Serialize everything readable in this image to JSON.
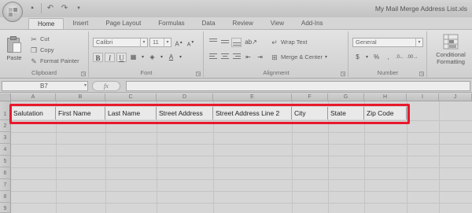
{
  "window": {
    "title": "My Mail Merge Address List.xls"
  },
  "qat": {
    "save_icon": "save-icon",
    "undo_icon": "undo-icon",
    "redo_icon": "redo-icon"
  },
  "tabs": [
    "Home",
    "Insert",
    "Page Layout",
    "Formulas",
    "Data",
    "Review",
    "View",
    "Add-Ins"
  ],
  "ribbon": {
    "clipboard": {
      "label": "Clipboard",
      "paste": "Paste",
      "cut": "Cut",
      "copy": "Copy",
      "format_painter": "Format Painter"
    },
    "font": {
      "label": "Font",
      "font_name": "Calibri",
      "font_size": "11"
    },
    "alignment": {
      "label": "Alignment",
      "wrap_text": "Wrap Text",
      "merge_center": "Merge & Center"
    },
    "number": {
      "label": "Number",
      "format": "General",
      "currency_symbol": "$",
      "percent_symbol": "%"
    },
    "styles": {
      "conditional_formatting_line1": "Conditional",
      "conditional_formatting_line2": "Formatting"
    }
  },
  "formula_bar": {
    "name_box": "B7",
    "fx": "fx",
    "value": ""
  },
  "sheet": {
    "columns": [
      "A",
      "B",
      "C",
      "D",
      "E",
      "F",
      "G",
      "H",
      "I",
      "J"
    ],
    "rows": [
      "1",
      "2",
      "3",
      "4",
      "5",
      "6",
      "7",
      "8",
      "9"
    ],
    "row1": [
      "Salutation",
      "First Name",
      "Last Name",
      "Street Address",
      "Street Address Line 2",
      "City",
      "State",
      "Zip Code"
    ]
  },
  "colors": {
    "highlight_border": "#e8192c"
  }
}
